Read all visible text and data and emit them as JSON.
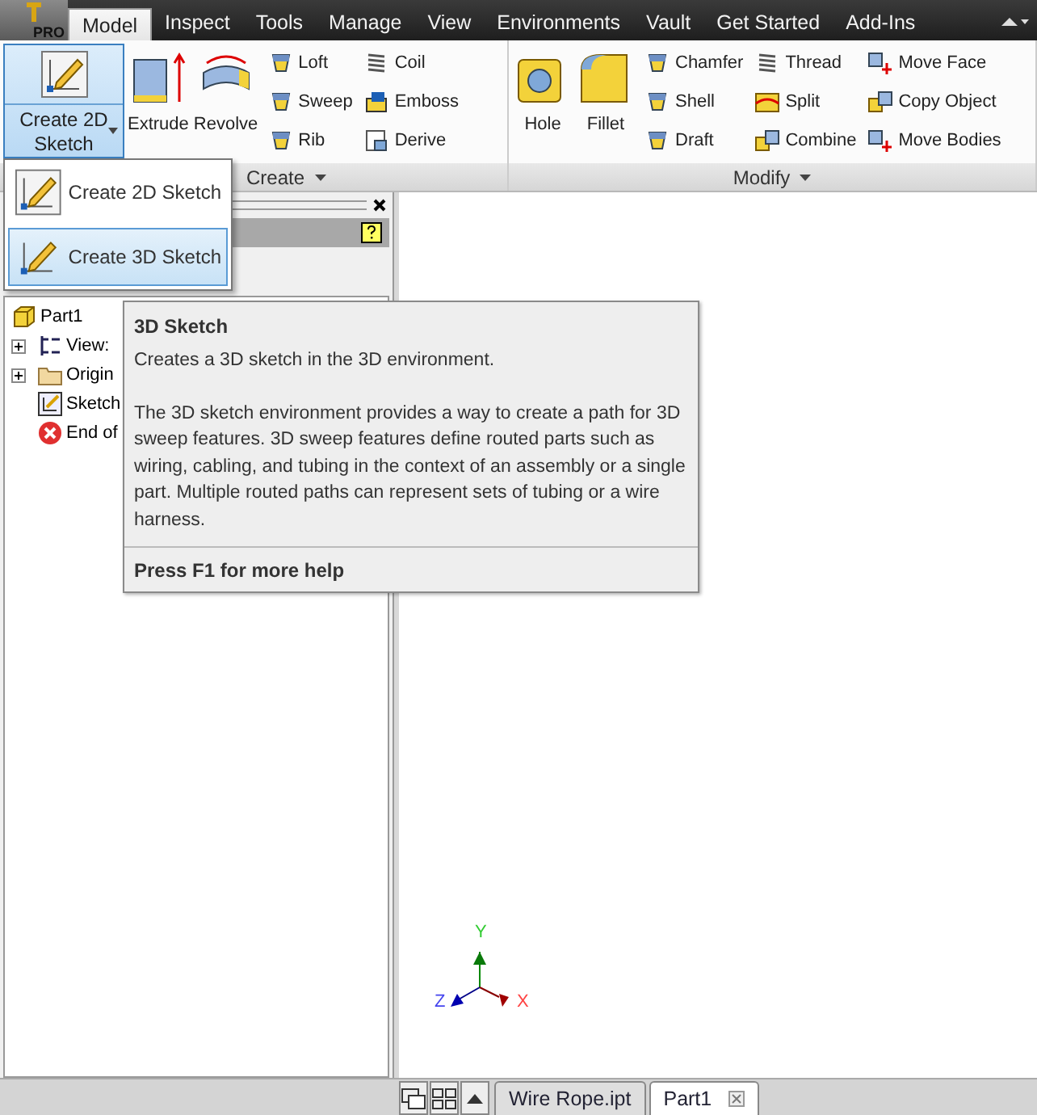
{
  "app_button": {
    "label": "PRO"
  },
  "tabs": [
    {
      "label": "Model",
      "selected": true
    },
    {
      "label": "Inspect",
      "selected": false
    },
    {
      "label": "Tools",
      "selected": false
    },
    {
      "label": "Manage",
      "selected": false
    },
    {
      "label": "View",
      "selected": false
    },
    {
      "label": "Environments",
      "selected": false
    },
    {
      "label": "Vault",
      "selected": false
    },
    {
      "label": "Get Started",
      "selected": false
    },
    {
      "label": "Add-Ins",
      "selected": false
    }
  ],
  "ribbon": {
    "create_panel": {
      "label": "Create",
      "sketch_button": {
        "label": "Create 2D Sketch",
        "open": true
      },
      "large_buttons": [
        "Extrude",
        "Revolve"
      ],
      "small_columns": [
        [
          "Loft",
          "Sweep",
          "Rib"
        ],
        [
          "Coil",
          "Emboss",
          "Derive"
        ]
      ]
    },
    "modify_panel": {
      "label": "Modify",
      "large_buttons": [
        "Hole",
        "Fillet"
      ],
      "small_columns": [
        [
          "Chamfer",
          "Shell",
          "Draft"
        ],
        [
          "Thread",
          "Split",
          "Combine"
        ],
        [
          "Move Face",
          "Copy Object",
          "Move Bodies"
        ]
      ]
    }
  },
  "sketch_menu": [
    {
      "label": "Create 2D Sketch",
      "selected": false
    },
    {
      "label": "Create 3D Sketch",
      "selected": true
    }
  ],
  "tooltip": {
    "title": "3D Sketch",
    "summary": "Creates a 3D sketch in the 3D environment.",
    "description": "The 3D sketch environment provides a way to create a path for 3D sweep features. 3D sweep features define routed parts such as wiring, cabling, and tubing in the context of an assembly or a single part. Multiple routed paths can represent sets of tubing or a wire harness.",
    "footer": "Press F1 for more help"
  },
  "browser": {
    "tree": [
      {
        "label": "Part1",
        "kind": "part",
        "children": [
          {
            "label": "View:",
            "kind": "view",
            "expanded": false
          },
          {
            "label": "Origin",
            "kind": "folder",
            "expanded": false
          },
          {
            "label": "Sketch",
            "kind": "sketch"
          },
          {
            "label": "End of",
            "kind": "end"
          }
        ]
      }
    ]
  },
  "viewport": {
    "axes": {
      "x": "X",
      "y": "Y",
      "z": "Z"
    }
  },
  "document_tabs": [
    {
      "label": "Wire Rope.ipt",
      "selected": false
    },
    {
      "label": "Part1",
      "selected": true
    }
  ]
}
